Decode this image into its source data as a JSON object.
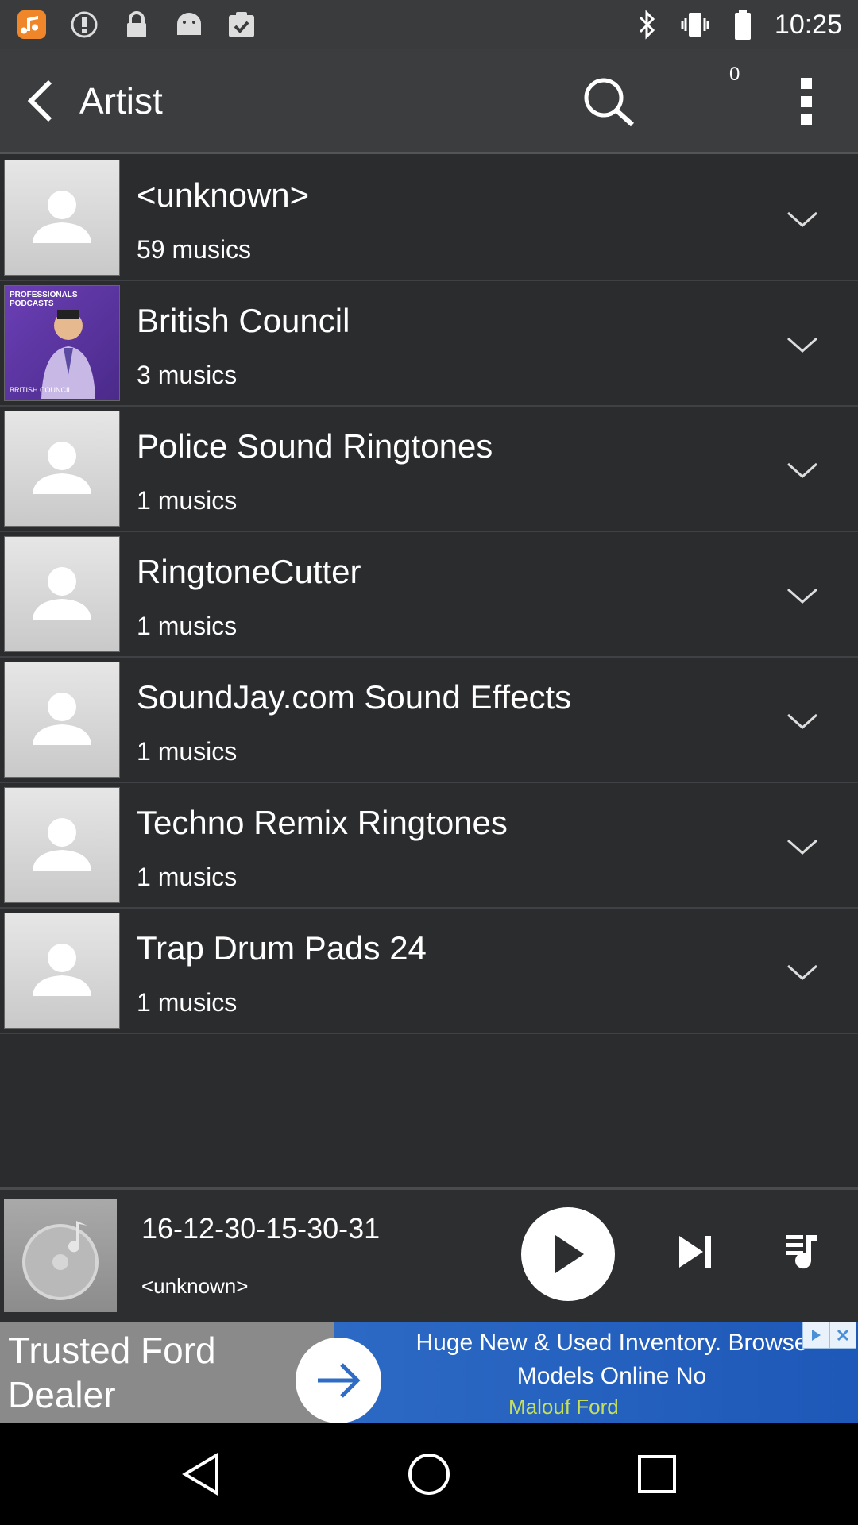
{
  "status_bar": {
    "time": "10:25",
    "icons": [
      "music-app-icon",
      "alert-icon",
      "lock-icon",
      "android-icon",
      "clipboard-check-icon",
      "bluetooth-icon",
      "vibrate-icon",
      "battery-icon"
    ]
  },
  "header": {
    "title": "Artist",
    "queue_count": "0"
  },
  "artists": [
    {
      "name": "<unknown>",
      "count": "59 musics",
      "thumb": "default"
    },
    {
      "name": "British Council",
      "count": "3 musics",
      "thumb": "british-council"
    },
    {
      "name": "Police Sound Ringtones",
      "count": "1 musics",
      "thumb": "default"
    },
    {
      "name": "RingtoneCutter",
      "count": "1 musics",
      "thumb": "default"
    },
    {
      "name": "SoundJay.com Sound Effects",
      "count": "1 musics",
      "thumb": "default"
    },
    {
      "name": "Techno Remix Ringtones",
      "count": "1 musics",
      "thumb": "default"
    },
    {
      "name": "Trap Drum Pads 24",
      "count": "1 musics",
      "thumb": "default"
    }
  ],
  "bc_thumb": {
    "top_text": "PROFESSIONALS PODCASTS",
    "bottom_text": "BRITISH COUNCIL"
  },
  "player": {
    "track_title": "16-12-30-15-30-31",
    "track_artist": "<unknown>"
  },
  "ad": {
    "headline": "Trusted Ford Dealer",
    "body": "Huge New & Used Inventory. Browse Models Online No",
    "brand": "Malouf Ford"
  },
  "colors": {
    "background": "#2b2c2e",
    "header": "#3c3d3f",
    "ad_blue": "#1e58b8",
    "ad_brand": "#c6e05a"
  }
}
